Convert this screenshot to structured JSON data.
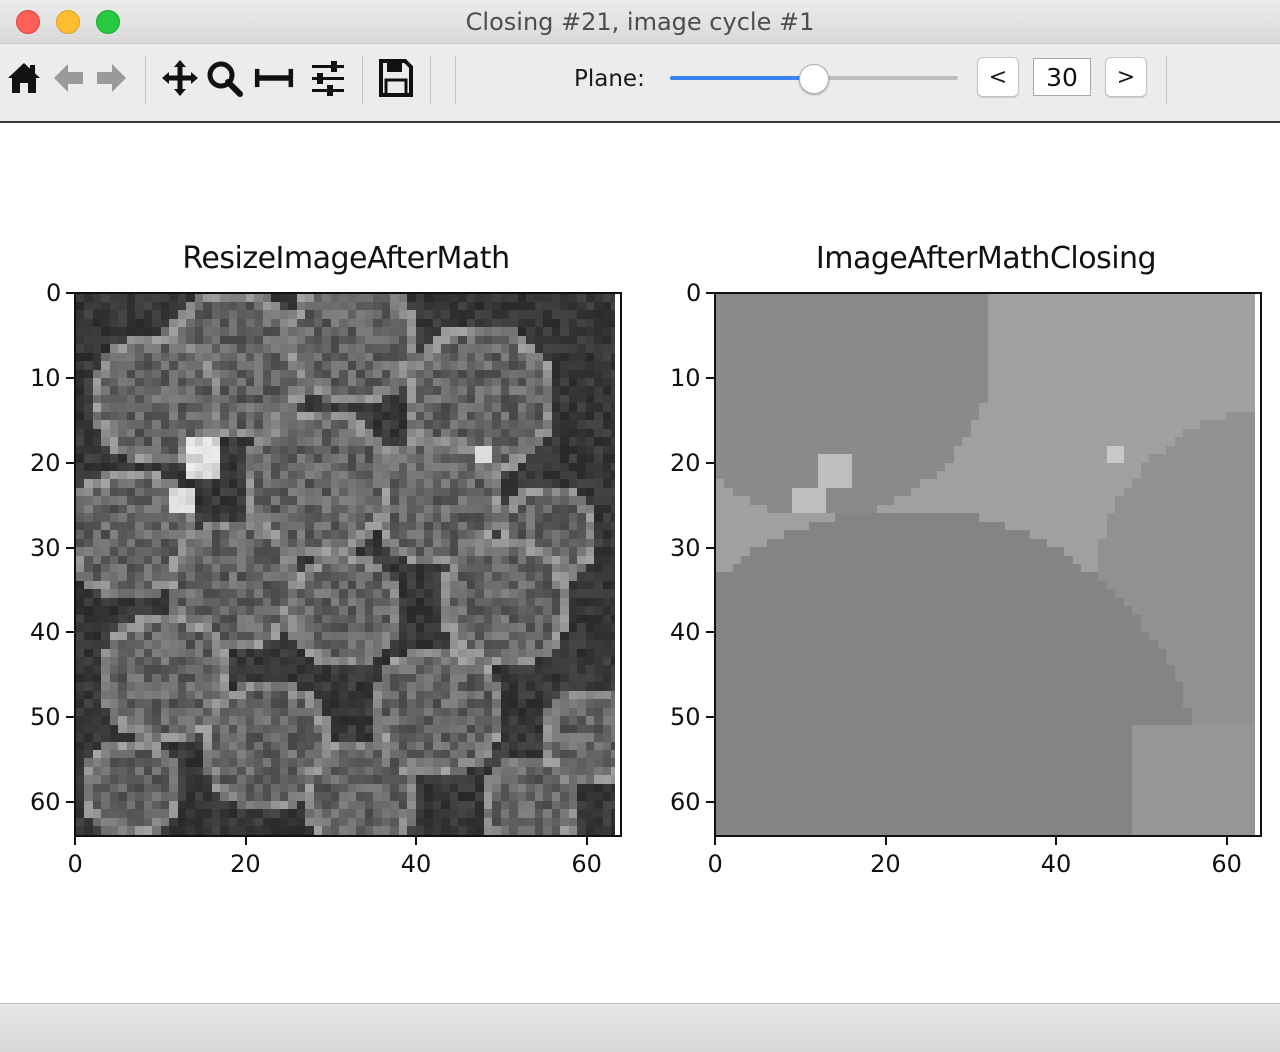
{
  "window": {
    "title": "Closing #21, image cycle #1"
  },
  "toolbar": {
    "icons": [
      "home-icon",
      "back-arrow-icon",
      "forward-arrow-icon",
      "pan-icon",
      "zoom-icon",
      "subplots-icon",
      "configure-icon",
      "save-icon"
    ],
    "plane_label": "Plane:",
    "plane_value": "30",
    "plane_slider_fraction": 0.5,
    "prev_label": "<",
    "next_label": ">",
    "accent_color": "#3b82f6"
  },
  "panels": [
    {
      "title": "ResizeImageAfterMath",
      "x_ticks": [
        "0",
        "20",
        "40",
        "60"
      ],
      "y_ticks": [
        "0",
        "10",
        "20",
        "30",
        "40",
        "50",
        "60"
      ]
    },
    {
      "title": "ImageAfterMathClosing",
      "x_ticks": [
        "0",
        "20",
        "40",
        "60"
      ],
      "y_ticks": [
        "0",
        "10",
        "20",
        "30",
        "40",
        "50",
        "60"
      ]
    }
  ]
}
